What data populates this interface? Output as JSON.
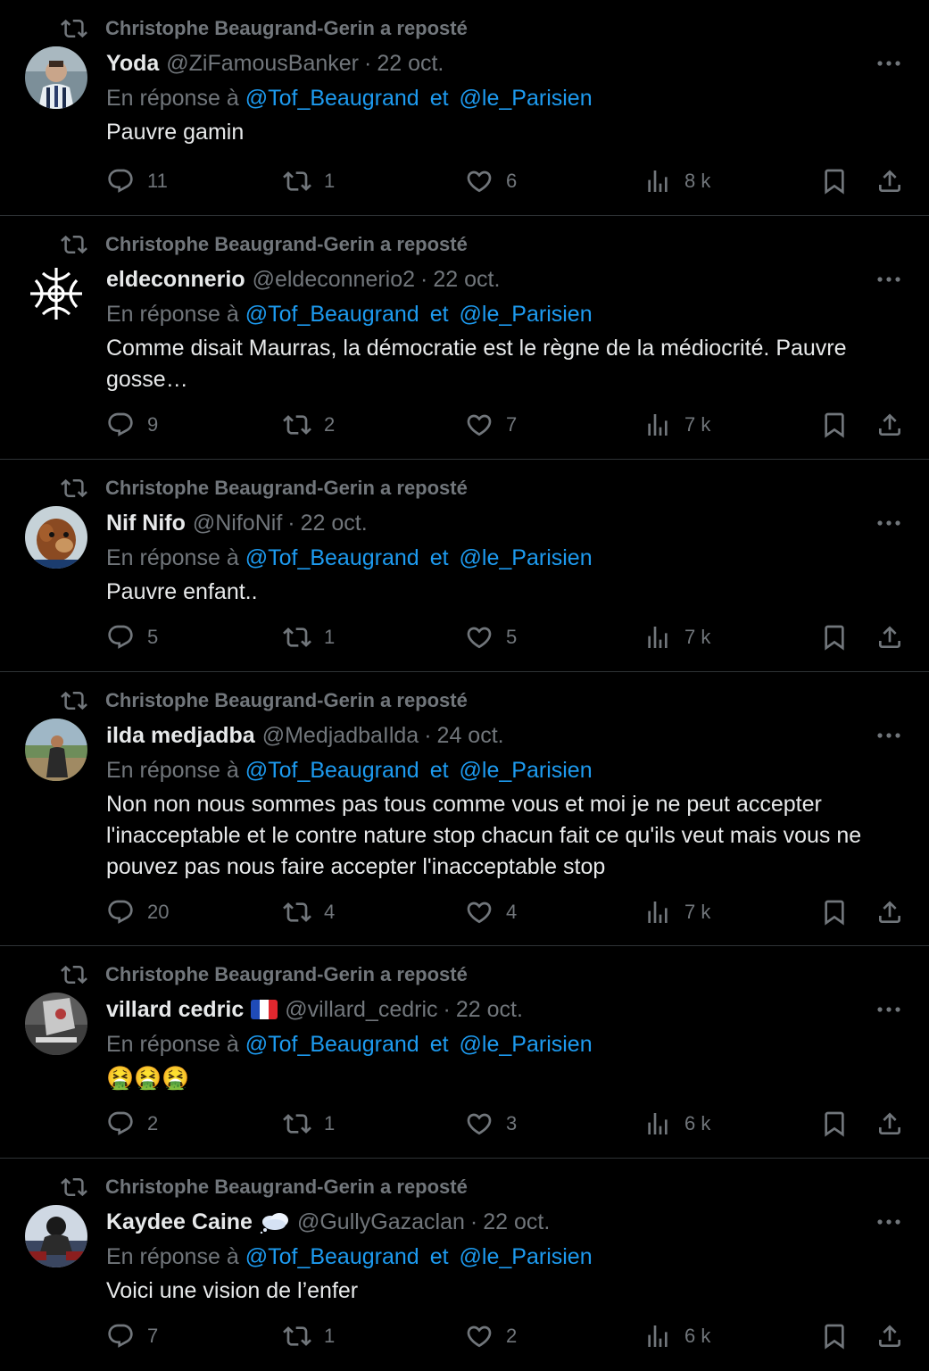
{
  "repost_text": "Christophe Beaugrand-Gerin a reposté",
  "reply_prefix": "En réponse à",
  "mention1": "@Tof_Beaugrand",
  "joiner": "et",
  "mention2": "@le_Parisien",
  "colors": {
    "background": "#000000",
    "muted": "#71767b",
    "link": "#1d9bf0",
    "text": "#e7e9ea",
    "divider": "#2f3336"
  },
  "tweets": [
    {
      "name": "Yoda",
      "handle": "@ZiFamousBanker",
      "date": "22 oct.",
      "text": "Pauvre gamin",
      "replies": "11",
      "reposts": "1",
      "likes": "6",
      "views": "8 k"
    },
    {
      "name": "eldeconnerio",
      "handle": "@eldeconnerio2",
      "date": "22 oct.",
      "text": "Comme disait Maurras, la démocratie est le règne de la médiocrité. Pauvre gosse…",
      "replies": "9",
      "reposts": "2",
      "likes": "7",
      "views": "7 k"
    },
    {
      "name": "Nif Nifo",
      "handle": "@NifoNif",
      "date": "22 oct.",
      "text": "Pauvre enfant..",
      "replies": "5",
      "reposts": "1",
      "likes": "5",
      "views": "7 k"
    },
    {
      "name": "ilda medjadba",
      "handle": "@MedjadbaIlda",
      "date": "24 oct.",
      "text": "Non non nous sommes pas tous comme vous et moi je ne peut accepter l'inacceptable et le contre nature stop chacun fait ce qu'ils veut mais vous ne pouvez pas nous faire accepter l'inacceptable stop",
      "replies": "20",
      "reposts": "4",
      "likes": "4",
      "views": "7 k"
    },
    {
      "name": "villard cedric",
      "handle": "@villard_cedric",
      "date": "22 oct.",
      "text": "🤮🤮🤮",
      "replies": "2",
      "reposts": "1",
      "likes": "3",
      "views": "6 k"
    },
    {
      "name": "Kaydee Caine",
      "handle": "@GullyGazaclan",
      "date": "22 oct.",
      "text": "Voici une vision de l’enfer",
      "replies": "7",
      "reposts": "1",
      "likes": "2",
      "views": "6 k"
    }
  ]
}
